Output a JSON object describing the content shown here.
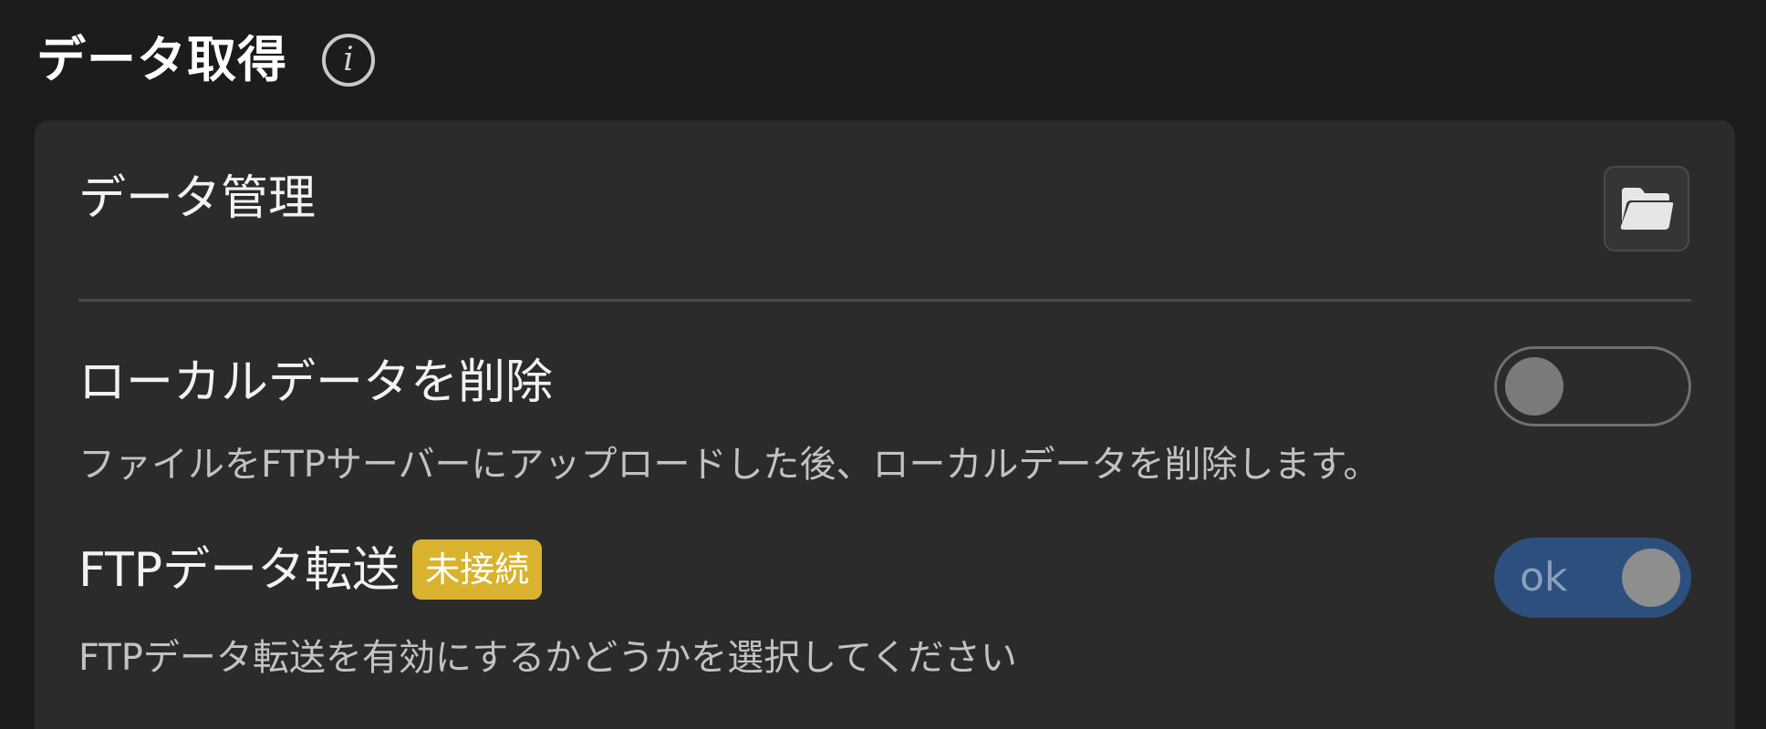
{
  "section": {
    "title": "データ取得",
    "info_icon": "info-icon"
  },
  "data_management": {
    "title": "データ管理",
    "icon": "folder-icon"
  },
  "delete_local": {
    "title": "ローカルデータを削除",
    "description": "ファイルをFTPサーバーにアップロードした後、ローカルデータを削除します。",
    "enabled": false
  },
  "ftp_transfer": {
    "title": "FTPデータ転送",
    "badge": "未接続",
    "description": "FTPデータ転送を有効にするかどうかを選択してください",
    "enabled": true,
    "toggle_label": "ok"
  },
  "colors": {
    "background": "#1c1c1c",
    "card": "#2b2b2b",
    "badge": "#d9b32e",
    "toggle_on": "#2c4f7d"
  }
}
